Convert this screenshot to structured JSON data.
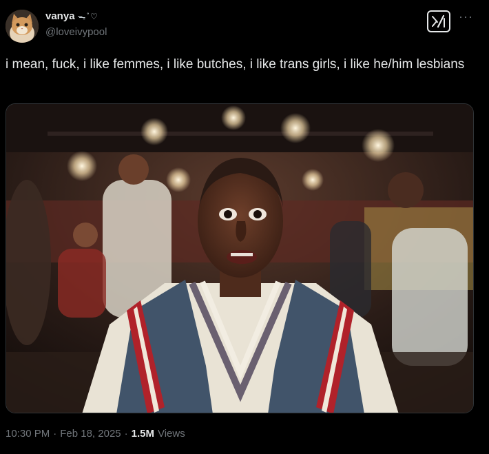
{
  "user": {
    "display_name": "vanya",
    "name_emoji": "ᯓ ̊ ♡",
    "handle": "@loveivypool"
  },
  "icons": {
    "avatar": "cat-avatar",
    "grok": "grok-icon",
    "more": "more-icon"
  },
  "tweet": {
    "text": "i mean, fuck, i like femmes, i like butches, i like trans girls, i like he/him lesbians"
  },
  "media": {
    "type": "video-still"
  },
  "meta": {
    "time": "10:30 PM",
    "separator": "·",
    "date": "Feb 18, 2025",
    "views_count": "1.5M",
    "views_label": "Views"
  },
  "colors": {
    "background": "#000000",
    "text": "#e7e9ea",
    "secondary": "#71767b"
  }
}
